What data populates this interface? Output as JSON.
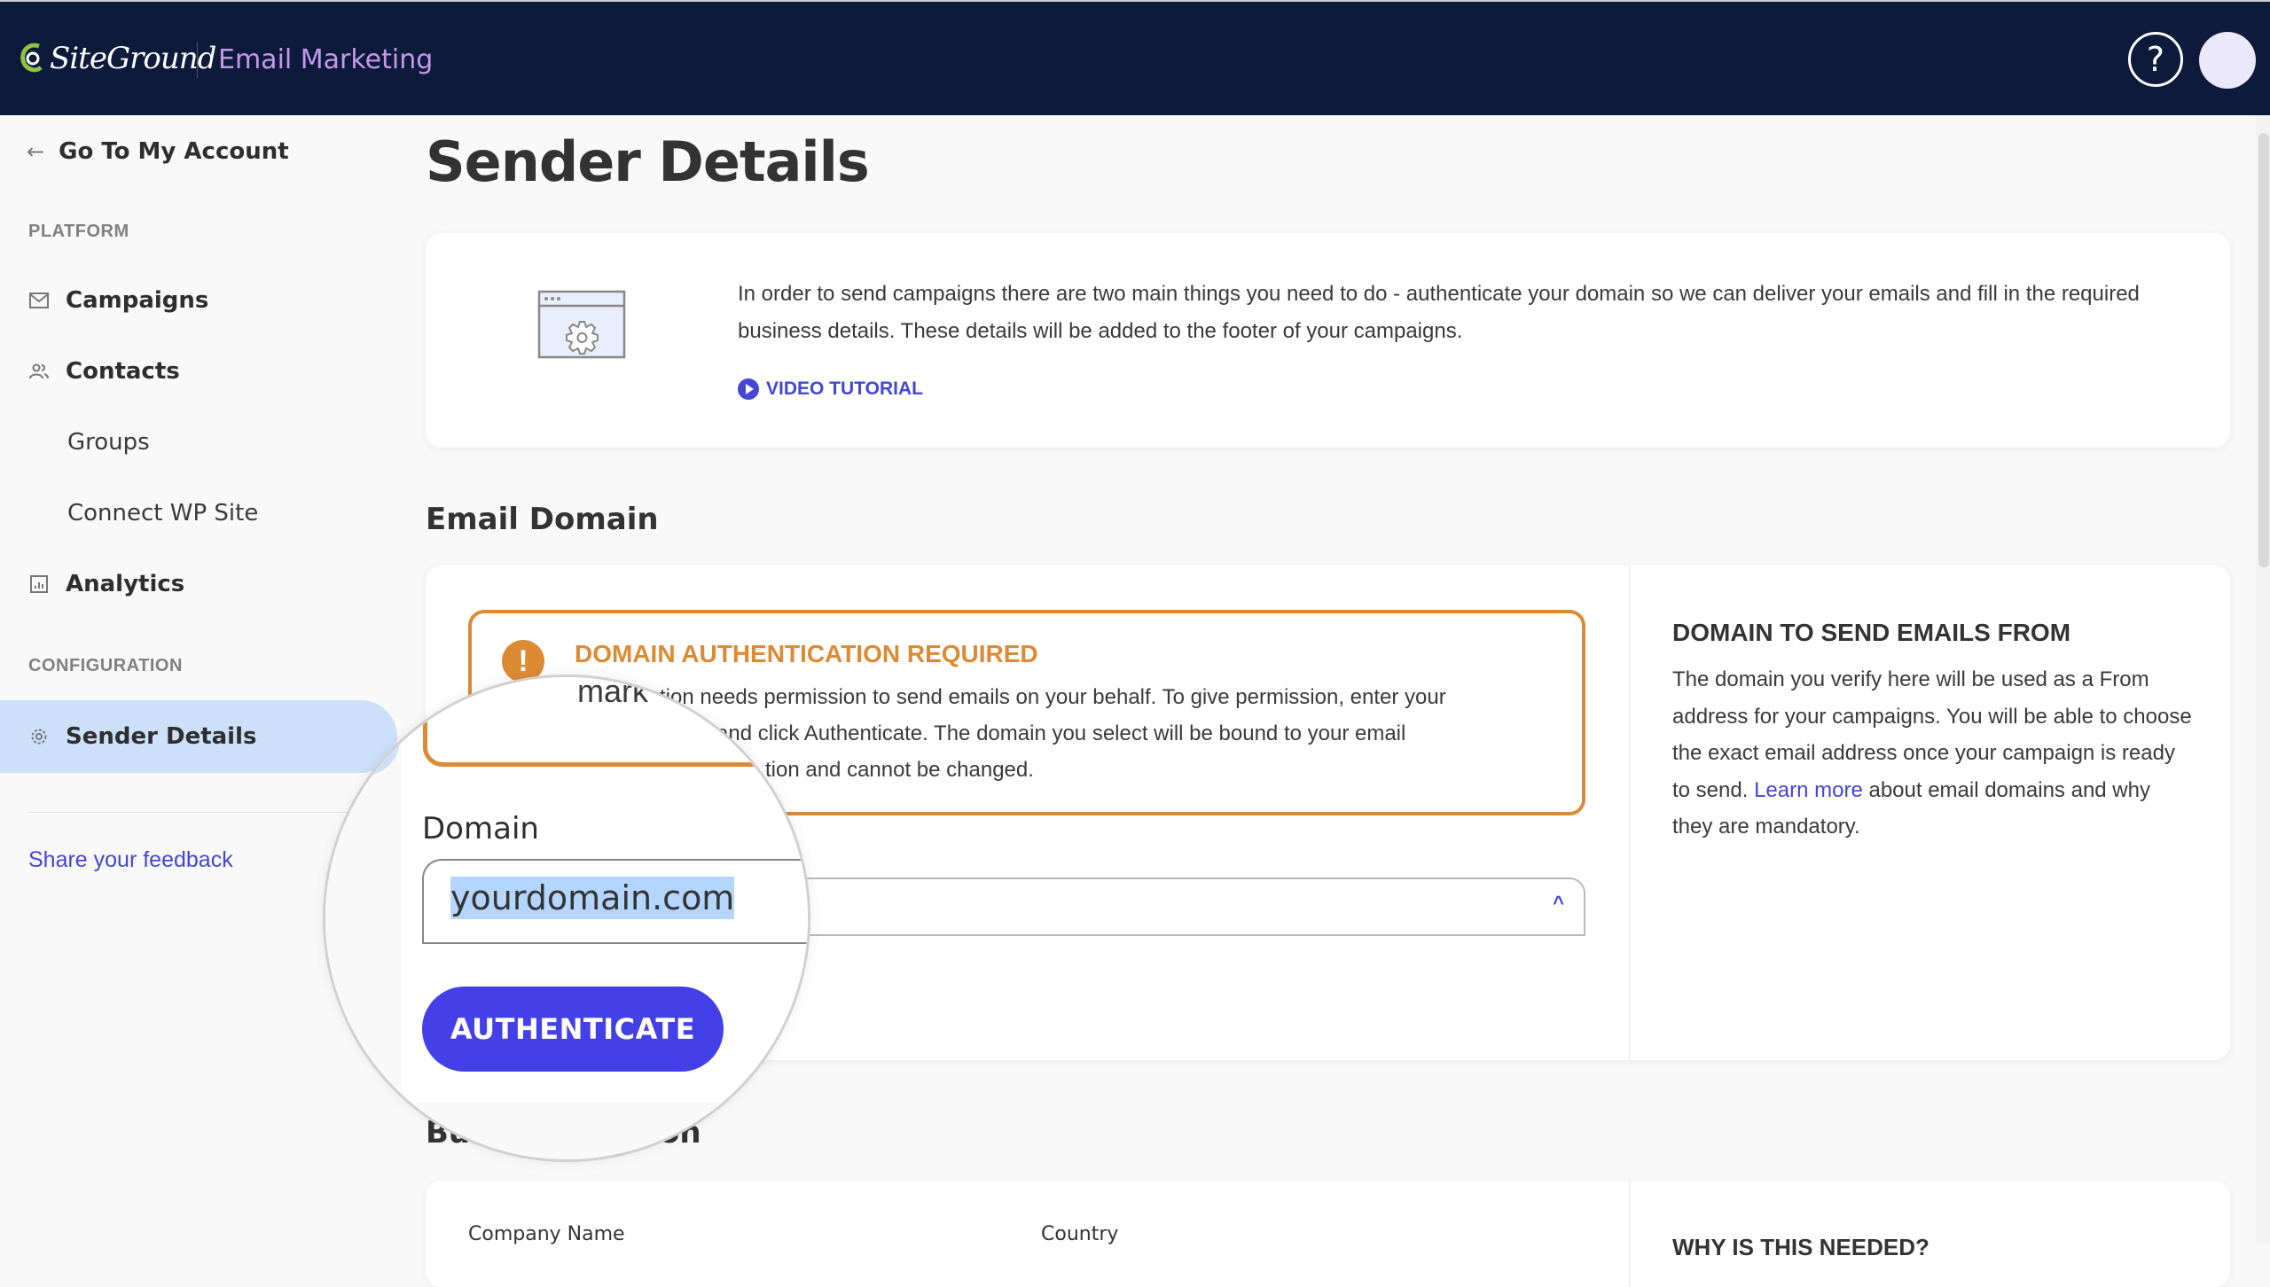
{
  "header": {
    "brand": "SiteGround",
    "app_title": "Email Marketing",
    "help_icon": "question-circle-icon",
    "help_glyph": "?"
  },
  "sidebar": {
    "back_label": "Go To My Account",
    "back_icon": "←",
    "platform_label": "PLATFORM",
    "configuration_label": "CONFIGURATION",
    "items": [
      {
        "label": "Campaigns",
        "icon": "envelope-icon"
      },
      {
        "label": "Contacts",
        "icon": "users-icon"
      },
      {
        "label": "Groups"
      },
      {
        "label": "Connect WP Site"
      },
      {
        "label": "Analytics",
        "icon": "chart-icon"
      },
      {
        "label": "Sender Details",
        "icon": "gear-icon",
        "active": true
      }
    ],
    "feedback_label": "Share your feedback"
  },
  "page": {
    "title": "Sender Details",
    "intro_text": "In order to send campaigns there are two main things you need to do - authenticate your domain so we can deliver your emails and fill in the required business details. These details will be added to the footer of your campaigns.",
    "video_label": "VIDEO TUTORIAL"
  },
  "email_domain": {
    "section_title": "Email Domain",
    "alert_title": "DOMAIN AUTHENTICATION REQUIRED",
    "alert_icon": "!",
    "alert_body": "Email Marketing application needs permission to send emails on your behalf. To give permission, enter your domain and click Authenticate. The domain you select will be bound to your email marketing application and cannot be changed.",
    "alert_visible_lines": [
      "lication needs permission to send emails on your behalf. To give permission, enter your",
      "and click Authenticate. The domain you select will be bound to your email",
      "tion and cannot be changed."
    ],
    "domain_label": "Domain",
    "domain_value": "yourdomain.com",
    "select_chevron": "^",
    "authenticate_label": "AUTHENTICATE",
    "info_title": "DOMAIN TO SEND EMAILS FROM",
    "info_text_before": "The domain you verify here will be used as a From address for your campaigns. You will be able to choose the exact email address once your campaign is ready to send. ",
    "info_link": "Learn more",
    "info_text_after": " about email domains and why they are mandatory."
  },
  "business": {
    "section_title": "Business Information",
    "section_title_visible_left": "Bu",
    "section_title_visible_right": "ation",
    "company_label": "Company Name",
    "country_label": "Country",
    "why_title": "WHY IS THIS NEEDED?"
  },
  "lens": {
    "partial_text": "mark",
    "partial_line2": "and click Auth",
    "partial_line3": "tion and c"
  },
  "colors": {
    "topbar": "#0e1a3c",
    "accent": "#4340e8",
    "link": "#4545d6",
    "warning": "#dd8a34",
    "active_nav": "#cde0fa",
    "app_title": "#c49ae8"
  }
}
